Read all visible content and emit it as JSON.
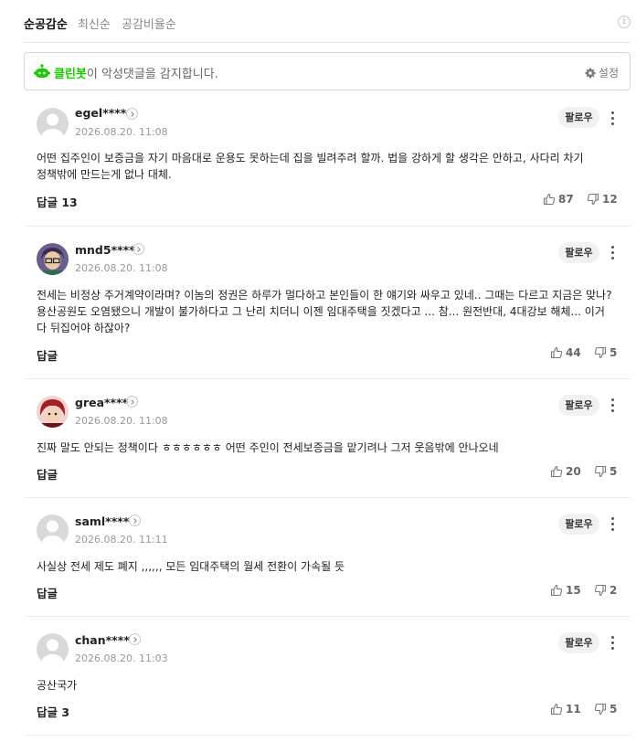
{
  "tabs": [
    {
      "label": "순공감순",
      "active": true
    },
    {
      "label": "최신순",
      "active": false
    },
    {
      "label": "공감비율순",
      "active": false
    }
  ],
  "info_icon": "info-icon",
  "cleanbot": {
    "name": "클린봇",
    "message": "이 악성댓글을 감지합니다.",
    "settings_label": "설정",
    "accent_color": "#1ec800"
  },
  "comments": [
    {
      "nickname": "egel****",
      "date": "2026.08.20. 11:08",
      "follow_label": "팔로우",
      "text": "어떤 집주인이 보증금을 자기 마음대로 운용도 못하는데 집을 빌려주려 할까. 법을 강하게 할 생각은 안하고, 사다리 차기 정책밖에 만드는게 없나 대체.",
      "reply_label": "답글 13",
      "likes": "87",
      "dislikes": "12"
    },
    {
      "nickname": "mnd5****",
      "date": "2026.08.20. 11:08",
      "follow_label": "팔로우",
      "text": "전세는 비정상 주거계약이라며? 이놈의 정권은 하루가 멀다하고 본인들이 한 얘기와 싸우고 있네.. 그때는 다르고 지금은 맞나? 용산공원도 오염됐으니 개발이 불가하다고 그 난리 치더니 이젠 임대주택을 짓겠다고 ... 참... 원전반대, 4대강보 해체... 이거 다 뒤집어야 하잖아?",
      "reply_label": "답글",
      "likes": "44",
      "dislikes": "5"
    },
    {
      "nickname": "grea****",
      "date": "2026.08.20. 11:08",
      "follow_label": "팔로우",
      "text": "진짜 말도 안되는 정책이다 ㅎㅎㅎㅎㅎㅎ 어떤 주인이 전세보증금을 맡기려나 그저 웃음밖에 안나오네",
      "reply_label": "답글",
      "likes": "20",
      "dislikes": "5"
    },
    {
      "nickname": "saml****",
      "date": "2026.08.20. 11:11",
      "follow_label": "팔로우",
      "text": "사실상 전세 제도 폐지 ,,,,,, 모든 임대주택의 월세 전환이 가속될 듯",
      "reply_label": "답글",
      "likes": "15",
      "dislikes": "2"
    },
    {
      "nickname": "chan****",
      "date": "2026.08.20. 11:03",
      "follow_label": "팔로우",
      "text": "공산국가",
      "reply_label": "답글 3",
      "likes": "11",
      "dislikes": "5"
    }
  ]
}
